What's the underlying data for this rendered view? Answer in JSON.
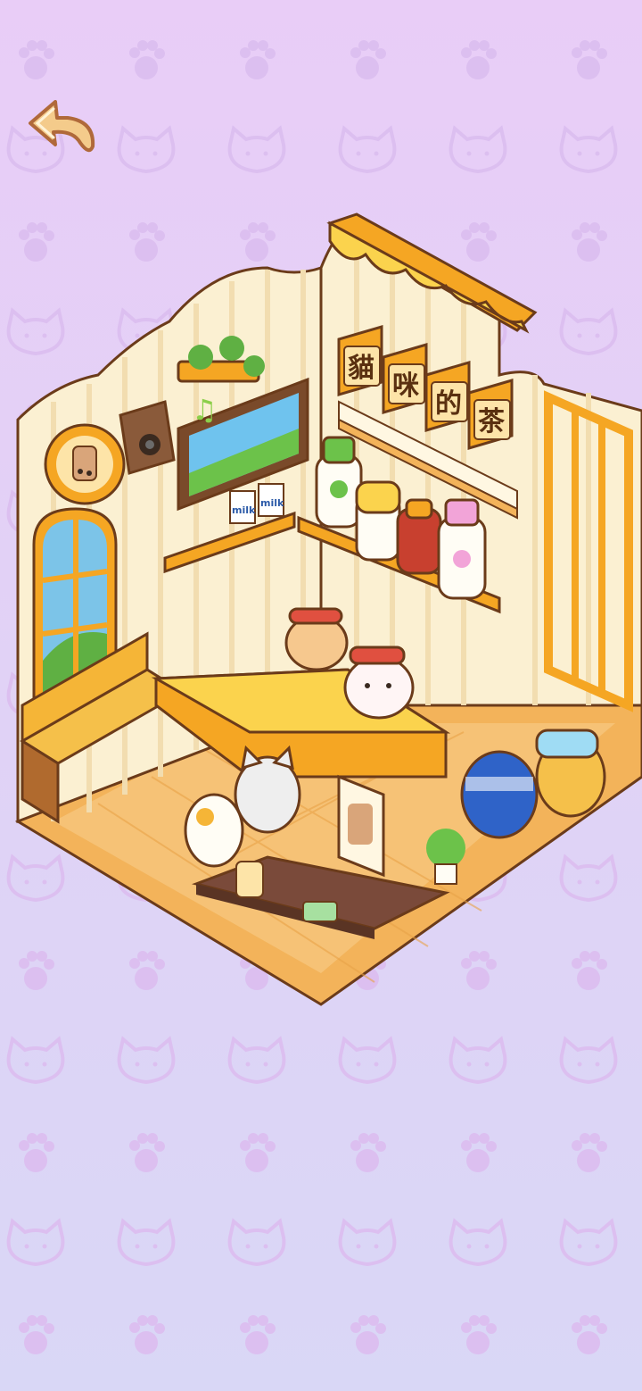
{
  "game": {
    "shop_sign_chars": [
      "貓",
      "咪",
      "的",
      "茶"
    ],
    "milk_label": "milk"
  },
  "icons": {
    "back": "back-arrow-icon",
    "paw": "paw-icon",
    "cat_face": "cat-face-icon",
    "music": "music-note-icon"
  },
  "colors": {
    "background_top": "#e9cdf7",
    "background_bottom": "#d9d7f6",
    "awning_orange": "#f5a623",
    "wall_cream": "#fbf0d2",
    "floor_orange": "#f3b35a",
    "back_button": "#f2c47e"
  }
}
